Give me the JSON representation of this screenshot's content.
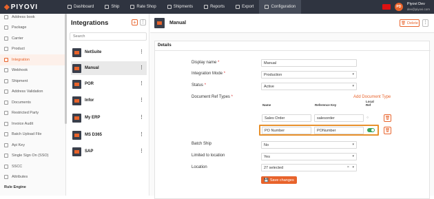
{
  "app": {
    "logo": "PIYOVI"
  },
  "topnav": [
    {
      "label": "Dashboard",
      "icon": "dashboard-icon"
    },
    {
      "label": "Ship",
      "icon": "ship-icon"
    },
    {
      "label": "Rate Shop",
      "icon": "rate-shop-icon"
    },
    {
      "label": "Shipments",
      "icon": "shipments-icon"
    },
    {
      "label": "Reports",
      "icon": "reports-icon"
    },
    {
      "label": "Export",
      "icon": "export-icon"
    },
    {
      "label": "Configuration",
      "icon": "configuration-icon",
      "active": true
    }
  ],
  "user": {
    "initials": "PD",
    "name": "Piyovi Dev",
    "email": "dev@piyovi.com"
  },
  "sidebar": {
    "items": [
      {
        "label": "Address book"
      },
      {
        "label": "Package"
      },
      {
        "label": "Carrier"
      },
      {
        "label": "Product"
      },
      {
        "label": "Integration",
        "active": true
      },
      {
        "label": "Webhook"
      },
      {
        "label": "Shipment"
      },
      {
        "label": "Address Validation"
      },
      {
        "label": "Documents"
      },
      {
        "label": "Restricted Party"
      },
      {
        "label": "Invoice Audit"
      },
      {
        "label": "Batch Upload File"
      },
      {
        "label": "Api Key"
      },
      {
        "label": "Single Sign On (SSO)"
      },
      {
        "label": "SSCC"
      },
      {
        "label": "Attributes"
      }
    ],
    "group": "Rule Engine"
  },
  "integrations": {
    "title": "Integrations",
    "search_placeholder": "Search",
    "items": [
      "NetSuite",
      "Manual",
      "POR",
      "Infor",
      "My ERP",
      "MS D365",
      "SAP"
    ],
    "selected": "Manual"
  },
  "main": {
    "title": "Manual",
    "delete_label": "Delete",
    "section_title": "Details",
    "fields": {
      "display_name": {
        "label": "Display name",
        "value": "Manual"
      },
      "integration_mode": {
        "label": "Integration Mode",
        "value": "Production"
      },
      "status": {
        "label": "Status",
        "value": "Active"
      },
      "doc_ref_types": {
        "label": "Document Ref Types"
      },
      "batch_ship": {
        "label": "Batch Ship",
        "value": "No"
      },
      "limited_to_location": {
        "label": "Limited to location",
        "value": "Yes"
      },
      "location": {
        "label": "Location",
        "value": "27 selected"
      }
    },
    "add_doc_type_label": "Add Document Type",
    "doc_table": {
      "headers": {
        "name": "Name",
        "reference_key": "Reference Key",
        "local_ref_1": "Local",
        "local_ref_2": "Ref"
      },
      "rows": [
        {
          "name": "Sales Order",
          "reference_key": "salesorder",
          "local_ref": false
        },
        {
          "name": "PO Number",
          "reference_key": "PONumber",
          "local_ref": true
        }
      ]
    },
    "save_label": "Save changes"
  },
  "colors": {
    "accent": "#e8632b",
    "topbar": "#2f3440",
    "highlight": "#e8902b",
    "toggle_on": "#3aa35b"
  }
}
